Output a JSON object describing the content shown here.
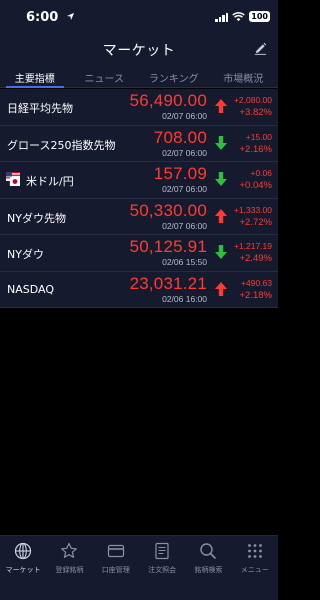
{
  "status": {
    "time": "6:00",
    "battery": "100"
  },
  "header": {
    "title": "マーケット"
  },
  "tabs": [
    {
      "label": "主要指標",
      "active": true
    },
    {
      "label": "ニュース",
      "active": false
    },
    {
      "label": "ランキング",
      "active": false
    },
    {
      "label": "市場概況",
      "active": false
    }
  ],
  "rows": [
    {
      "name": "日経平均先物",
      "price": "56,490.00",
      "time": "02/07 06:00",
      "direction": "up",
      "change": "+2,080.00",
      "pct": "+3.82%"
    },
    {
      "name": "グロース250指数先物",
      "price": "708.00",
      "time": "02/07 06:00",
      "direction": "down",
      "change": "+15.00",
      "pct": "+2.16%"
    },
    {
      "name": "米ドル/円",
      "price": "157.09",
      "time": "02/07 06:00",
      "direction": "down",
      "change": "+0.06",
      "pct": "+0.04%",
      "flag": "us-jp"
    },
    {
      "name": "NYダウ先物",
      "price": "50,330.00",
      "time": "02/07 06:00",
      "direction": "up",
      "change": "+1,333.00",
      "pct": "+2.72%"
    },
    {
      "name": "NYダウ",
      "price": "50,125.91",
      "time": "02/06 15:50",
      "direction": "down",
      "change": "+1,217.19",
      "pct": "+2.49%"
    },
    {
      "name": "NASDAQ",
      "price": "23,031.21",
      "time": "02/06 16:00",
      "direction": "up",
      "change": "+490.63",
      "pct": "+2.18%"
    }
  ],
  "nav": [
    {
      "label": "マーケット",
      "icon": "globe-icon",
      "active": true
    },
    {
      "label": "登録銘柄",
      "icon": "star-icon",
      "active": false
    },
    {
      "label": "口座管理",
      "icon": "card-icon",
      "active": false
    },
    {
      "label": "注文照会",
      "icon": "document-icon",
      "active": false
    },
    {
      "label": "銘柄検索",
      "icon": "search-icon",
      "active": false
    },
    {
      "label": "メニュー",
      "icon": "grid-icon",
      "active": false
    }
  ],
  "colors": {
    "up_arrow": "#ff3b30",
    "down_arrow": "#2fbf3a",
    "value_red": "#ff3b30",
    "background": "#161a2e",
    "accent": "#4a6cf0"
  }
}
